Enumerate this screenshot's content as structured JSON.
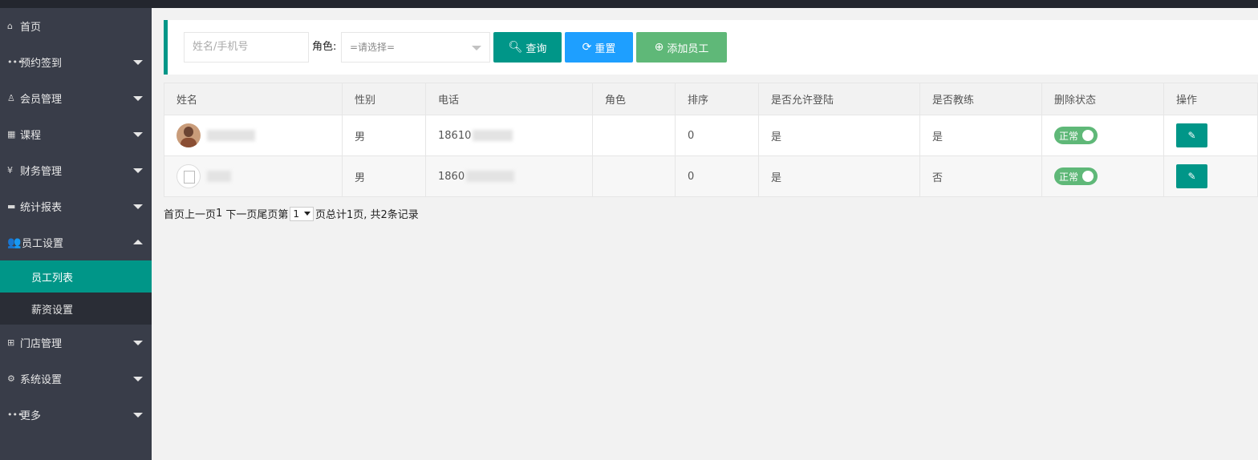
{
  "sidebar": {
    "items": [
      {
        "label": "首页",
        "icon": "home-icon"
      },
      {
        "label": "预约签到",
        "icon": "more-dots-icon"
      },
      {
        "label": "会员管理",
        "icon": "user-icon"
      },
      {
        "label": "课程",
        "icon": "grid-icon"
      },
      {
        "label": "财务管理",
        "icon": "yen-icon"
      },
      {
        "label": "统计报表",
        "icon": "chart-icon"
      },
      {
        "label": "员工设置",
        "icon": "users-icon"
      },
      {
        "label": "门店管理",
        "icon": "apps-icon"
      },
      {
        "label": "系统设置",
        "icon": "gear-icon"
      },
      {
        "label": "更多",
        "icon": "more-dots-icon"
      }
    ],
    "sub_items": [
      {
        "label": "员工列表",
        "active": true
      },
      {
        "label": "薪资设置",
        "active": false
      }
    ]
  },
  "toolbar": {
    "search_placeholder": "姓名/手机号",
    "role_label": "角色:",
    "role_select_value": "=请选择=",
    "query_label": "查询",
    "reset_label": "重置",
    "add_label": "添加员工"
  },
  "table": {
    "headers": [
      "姓名",
      "性别",
      "电话",
      "角色",
      "排序",
      "是否允许登陆",
      "是否教练",
      "删除状态",
      "操作"
    ],
    "rows": [
      {
        "gender": "男",
        "phone": "18610",
        "role": "",
        "sort": "0",
        "login": "是",
        "coach": "是",
        "status": "正常"
      },
      {
        "gender": "男",
        "phone": "1860",
        "role": "",
        "sort": "0",
        "login": "是",
        "coach": "否",
        "status": "正常"
      }
    ]
  },
  "pager": {
    "first": "首页",
    "prev": "上一页",
    "current": "1",
    "next": "下一页",
    "last": "尾页",
    "page_prefix": "第",
    "page_select": "1",
    "summary": "页总计1页, 共2条记录"
  },
  "colors": {
    "primary": "#009688",
    "blue": "#1e9fff",
    "green": "#5fb878",
    "sidebar_bg": "#393d49"
  }
}
